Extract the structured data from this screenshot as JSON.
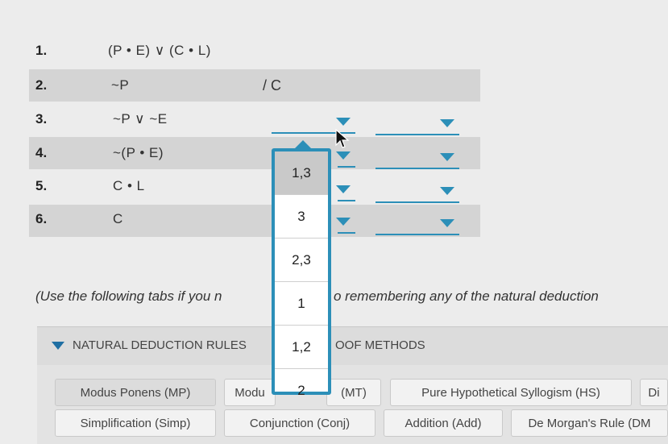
{
  "proof": {
    "lines": [
      {
        "num": "1.",
        "statement": "(P • E) ∨ (C • L)"
      },
      {
        "num": "2.",
        "statement": "~P",
        "conclusion": "/ C"
      },
      {
        "num": "3.",
        "statement": "~P ∨ ~E"
      },
      {
        "num": "4.",
        "statement": "~(P • E)"
      },
      {
        "num": "5.",
        "statement": "C • L"
      },
      {
        "num": "6.",
        "statement": "C"
      }
    ]
  },
  "dropdown_list": {
    "options": [
      "1,3",
      "3",
      "2,3",
      "1",
      "1,2",
      "2"
    ],
    "highlighted_index": 0
  },
  "note": {
    "left": "(Use the following tabs if you n",
    "right": "o remembering any of the natural deduction"
  },
  "panel": {
    "left_label": "NATURAL DEDUCTION RULES",
    "right_label": "OOF METHODS"
  },
  "tabs": {
    "row1": [
      "Modus Ponens (MP)",
      "Modu",
      "(MT)",
      "Pure Hypothetical Syllogism (HS)",
      "Di"
    ],
    "row2": [
      "Simplification (Simp)",
      "Conjunction (Conj)",
      "Addition (Add)",
      "De Morgan's Rule (DM"
    ]
  },
  "colors": {
    "accent": "#2c8fb8",
    "panel_triangle": "#1f6fa3"
  }
}
